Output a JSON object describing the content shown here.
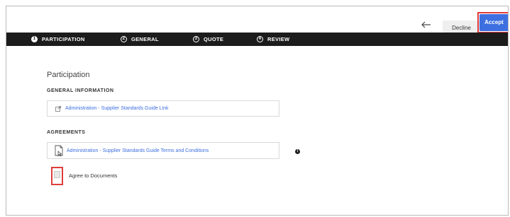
{
  "header": {
    "back_icon": "arrow-left-icon",
    "decline_label": "Decline",
    "accept_label": "Accept",
    "highlight_color": "#e03b3b",
    "accept_color": "#3d6fe0"
  },
  "stepper": {
    "steps": [
      {
        "number": "1",
        "label": "PARTICIPATION",
        "active": true
      },
      {
        "number": "2",
        "label": "GENERAL",
        "active": false
      },
      {
        "number": "3",
        "label": "QUOTE",
        "active": false
      },
      {
        "number": "4",
        "label": "REVIEW",
        "active": false
      }
    ]
  },
  "main": {
    "section_title": "Participation",
    "general_information": {
      "heading": "GENERAL INFORMATION",
      "link_label": "Administration - Supplier Standards Guide Link",
      "link_icon": "external-link-icon"
    },
    "agreements": {
      "heading": "AGREEMENTS",
      "document_label": "Administration - Supplier Standards Guide Terms and Conditions",
      "document_icon": "document-icon",
      "info_icon": "info-icon"
    },
    "agree_checkbox": {
      "label": "Agree to Documents",
      "checked": false
    }
  }
}
